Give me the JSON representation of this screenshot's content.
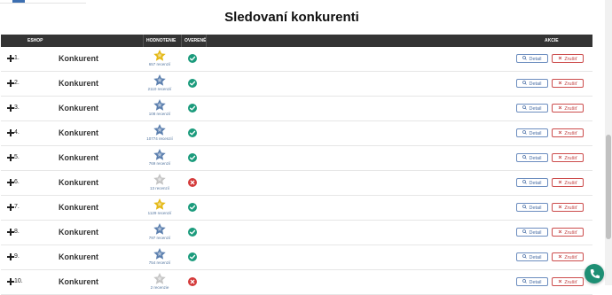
{
  "title": "Sledovaní konkurenti",
  "columns": {
    "eshop": "ESHOP",
    "rating": "HODNOTENIE",
    "verified": "OVERENÉ",
    "actions": "AKCIE"
  },
  "colors": {
    "star_gold": "#e4b814",
    "star_blue": "#5b7fae",
    "star_gray": "#c4c4c4",
    "verified_ok": "#1b9b7c",
    "verified_bad": "#d43a3a",
    "header_bg": "#343434"
  },
  "buttons": {
    "detail": "Detail",
    "cancel": "Zrušiť"
  },
  "icons": {
    "detail": "search-icon",
    "cancel": "times-icon",
    "expand": "plus-icon",
    "fab": "phone-icon"
  },
  "rows": [
    {
      "num": "1.",
      "name": "Konkurent",
      "reviews": "657 recenzií",
      "star": "gold",
      "verified": true
    },
    {
      "num": "2.",
      "name": "Konkurent",
      "reviews": "2110 recenzií",
      "star": "blue",
      "verified": true
    },
    {
      "num": "3.",
      "name": "Konkurent",
      "reviews": "108 recenzií",
      "star": "blue",
      "verified": true
    },
    {
      "num": "4.",
      "name": "Konkurent",
      "reviews": "10774 recenzií",
      "star": "blue",
      "verified": true
    },
    {
      "num": "5.",
      "name": "Konkurent",
      "reviews": "769 recenzií",
      "star": "blue",
      "verified": true
    },
    {
      "num": "6.",
      "name": "Konkurent",
      "reviews": "13 recenzií",
      "star": "gray",
      "verified": false
    },
    {
      "num": "7.",
      "name": "Konkurent",
      "reviews": "1129 recenzií",
      "star": "gold",
      "verified": true
    },
    {
      "num": "8.",
      "name": "Konkurent",
      "reviews": "797 recenzií",
      "star": "blue",
      "verified": true
    },
    {
      "num": "9.",
      "name": "Konkurent",
      "reviews": "754 recenzií",
      "star": "blue",
      "verified": true
    },
    {
      "num": "10.",
      "name": "Konkurent",
      "reviews": "2 recenzie",
      "star": "gray",
      "verified": false
    }
  ]
}
